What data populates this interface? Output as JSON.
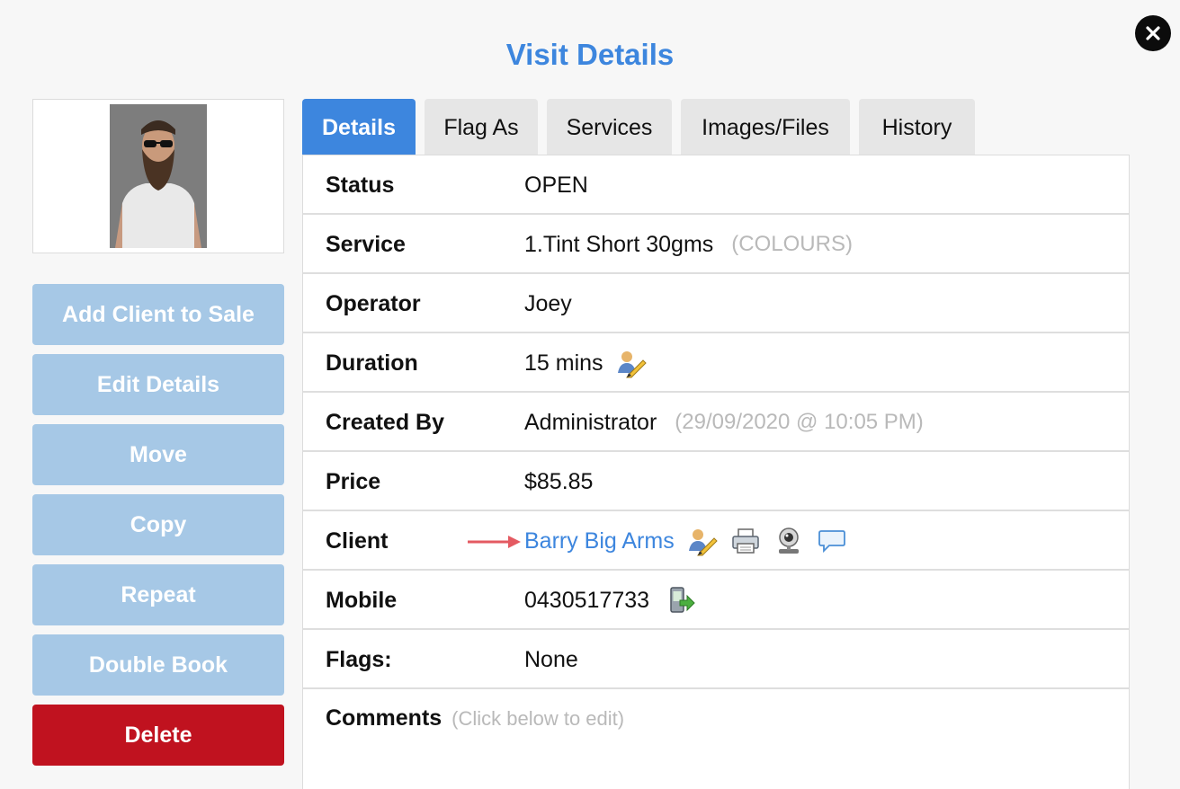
{
  "dialog": {
    "title": "Visit Details"
  },
  "sidebar": {
    "buttons": [
      {
        "label": "Add Client to Sale"
      },
      {
        "label": "Edit Details"
      },
      {
        "label": "Move"
      },
      {
        "label": "Copy"
      },
      {
        "label": "Repeat"
      },
      {
        "label": "Double Book"
      },
      {
        "label": "Delete"
      }
    ]
  },
  "tabs": [
    {
      "label": "Details",
      "active": true
    },
    {
      "label": "Flag As"
    },
    {
      "label": "Services"
    },
    {
      "label": "Images/Files"
    },
    {
      "label": "History"
    }
  ],
  "details": {
    "status": {
      "label": "Status",
      "value": "OPEN"
    },
    "service": {
      "label": "Service",
      "value": "1.Tint Short 30gms",
      "note": "(COLOURS)"
    },
    "operator": {
      "label": "Operator",
      "value": "Joey"
    },
    "duration": {
      "label": "Duration",
      "value": "15 mins"
    },
    "created_by": {
      "label": "Created By",
      "value": "Administrator",
      "note": "(29/09/2020 @ 10:05 PM)"
    },
    "price": {
      "label": "Price",
      "value": "$85.85"
    },
    "client": {
      "label": "Client",
      "value": "Barry Big Arms"
    },
    "mobile": {
      "label": "Mobile",
      "value": "0430517733"
    },
    "flags": {
      "label": "Flags:",
      "value": "None"
    },
    "comments": {
      "label": "Comments",
      "hint": "(Click below to edit)"
    }
  },
  "icons": {
    "close": "close-icon",
    "edit": "edit-user-icon",
    "print": "printer-icon",
    "webcam": "webcam-icon",
    "message": "speech-bubble-icon",
    "sms": "sms-phone-icon"
  },
  "colors": {
    "accent": "#3d86de",
    "disabled_button": "#a6c8e6",
    "danger": "#c0121f"
  }
}
